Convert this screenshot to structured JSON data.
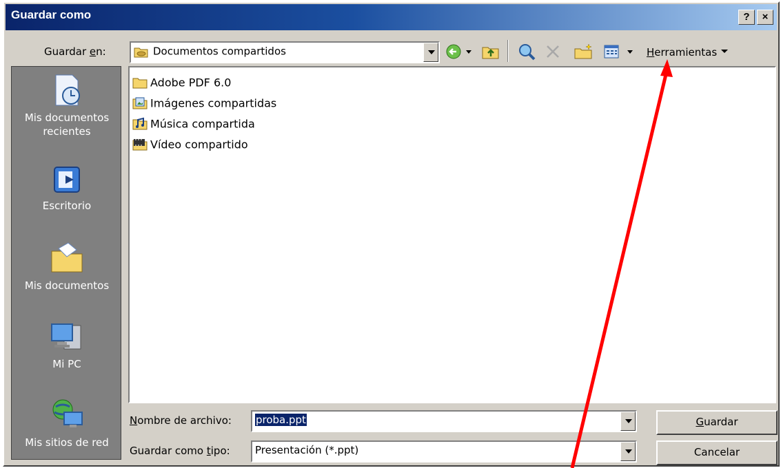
{
  "window": {
    "title": "Guardar como",
    "help_label": "?",
    "close_label": "×"
  },
  "save_in": {
    "label_pre": "Guardar ",
    "label_hot": "e",
    "label_post": "n:",
    "value": "Documentos compartidos"
  },
  "toolbar": {
    "tools_hot": "H",
    "tools_rest": "erramientas",
    "icons": [
      "back-icon",
      "up-folder-icon",
      "search-web-icon",
      "delete-icon",
      "new-folder-icon",
      "views-icon"
    ]
  },
  "places": [
    {
      "line1": "Mis documentos",
      "line2": "recientes",
      "icon": "recent-documents-icon"
    },
    {
      "line1": "Escritorio",
      "line2": "",
      "icon": "desktop-icon"
    },
    {
      "line1": "Mis documentos",
      "line2": "",
      "icon": "my-documents-icon"
    },
    {
      "line1": "Mi PC",
      "line2": "",
      "icon": "my-computer-icon"
    },
    {
      "line1": "Mis sitios de red",
      "line2": "",
      "icon": "network-places-icon"
    }
  ],
  "files": [
    {
      "name": "Adobe PDF 6.0",
      "icon": "folder-icon"
    },
    {
      "name": "Imágenes compartidas",
      "icon": "pictures-folder-icon"
    },
    {
      "name": "Música compartida",
      "icon": "music-folder-icon"
    },
    {
      "name": "Vídeo compartido",
      "icon": "video-folder-icon"
    }
  ],
  "filename": {
    "label_hot": "N",
    "label_rest": "ombre de archivo:",
    "value": "proba.ppt"
  },
  "filetype": {
    "label_pre": "Guardar como ",
    "label_hot": "t",
    "label_post": "ipo:",
    "value": "Presentación (*.ppt)"
  },
  "buttons": {
    "save_hot": "G",
    "save_rest": "uardar",
    "cancel": "Cancelar"
  },
  "annotation": {
    "color": "#ff0000"
  }
}
